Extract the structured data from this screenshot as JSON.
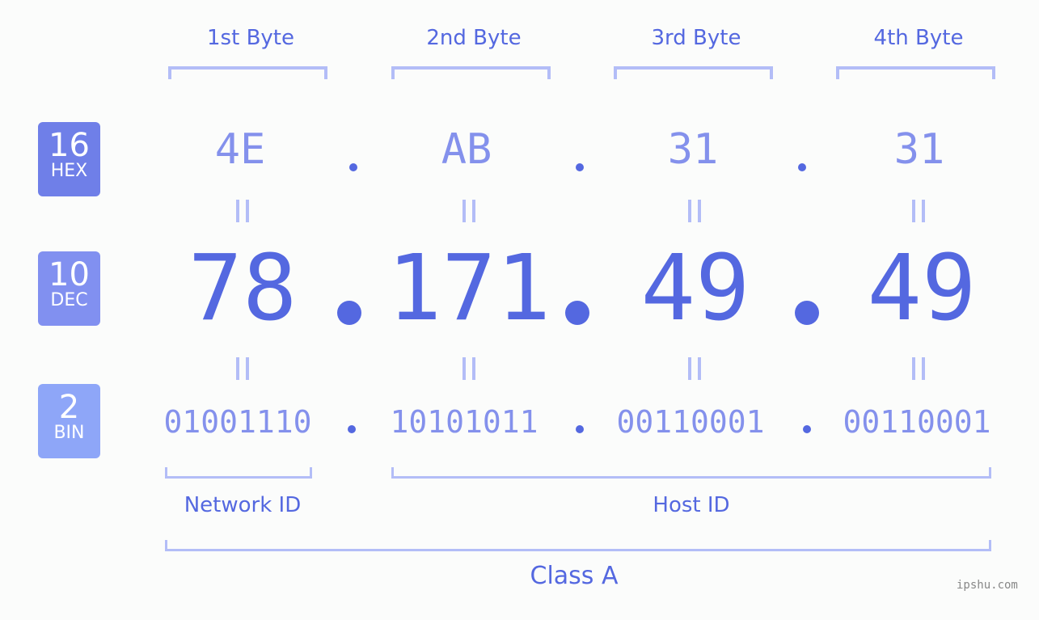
{
  "byte_headers": [
    "1st Byte",
    "2nd Byte",
    "3rd Byte",
    "4th Byte"
  ],
  "badges": {
    "hex": {
      "base": "16",
      "label": "HEX",
      "color": "#6f7fe8"
    },
    "dec": {
      "base": "10",
      "label": "DEC",
      "color": "#8190f0"
    },
    "bin": {
      "base": "2",
      "label": "BIN",
      "color": "#8ea6f8"
    }
  },
  "hex_values": [
    "4E",
    "AB",
    "31",
    "31"
  ],
  "dec_values": [
    "78",
    "171",
    "49",
    "49"
  ],
  "bin_values": [
    "01001110",
    "10101011",
    "00110001",
    "00110001"
  ],
  "labels": {
    "network_id": "Network ID",
    "host_id": "Host ID",
    "class": "Class A"
  },
  "colors": {
    "primary": "#5468e0",
    "secondary": "#8491ec",
    "bracket": "#b3bdf7",
    "background": "#fbfcfb"
  },
  "watermark": "ipshu.com"
}
